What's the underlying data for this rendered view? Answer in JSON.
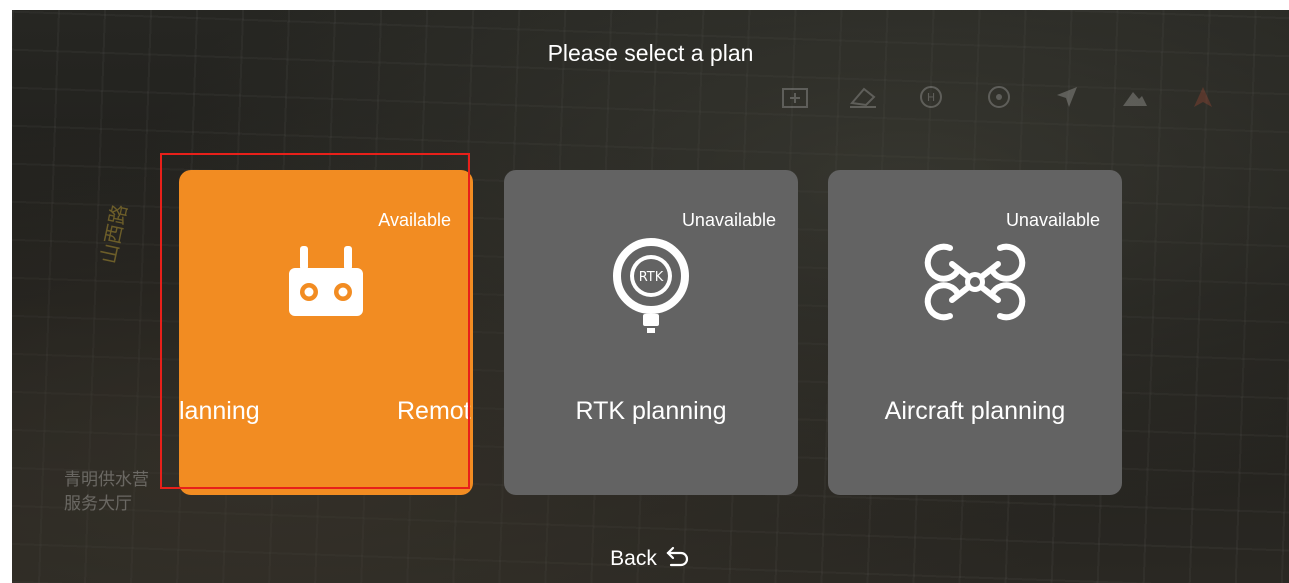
{
  "header": {
    "title": "Please select a plan"
  },
  "map": {
    "labels": [
      "青明供水营",
      "服务大厅"
    ],
    "road_label": "山西路"
  },
  "cards": {
    "remote": {
      "status": "Available",
      "label_left": "lanning",
      "label_right": "Remot",
      "color": "#f28c22",
      "icon": "remote-controller-icon"
    },
    "rtk": {
      "status": "Unavailable",
      "label": "RTK planning",
      "icon_text": "RTK",
      "color": "#636363",
      "icon": "rtk-module-icon"
    },
    "aircraft": {
      "status": "Unavailable",
      "label": "Aircraft planning",
      "color": "#636363",
      "icon": "drone-icon"
    }
  },
  "footer": {
    "back_label": "Back",
    "icon": "return-arrow-icon"
  },
  "highlight_color": "#e8201a"
}
